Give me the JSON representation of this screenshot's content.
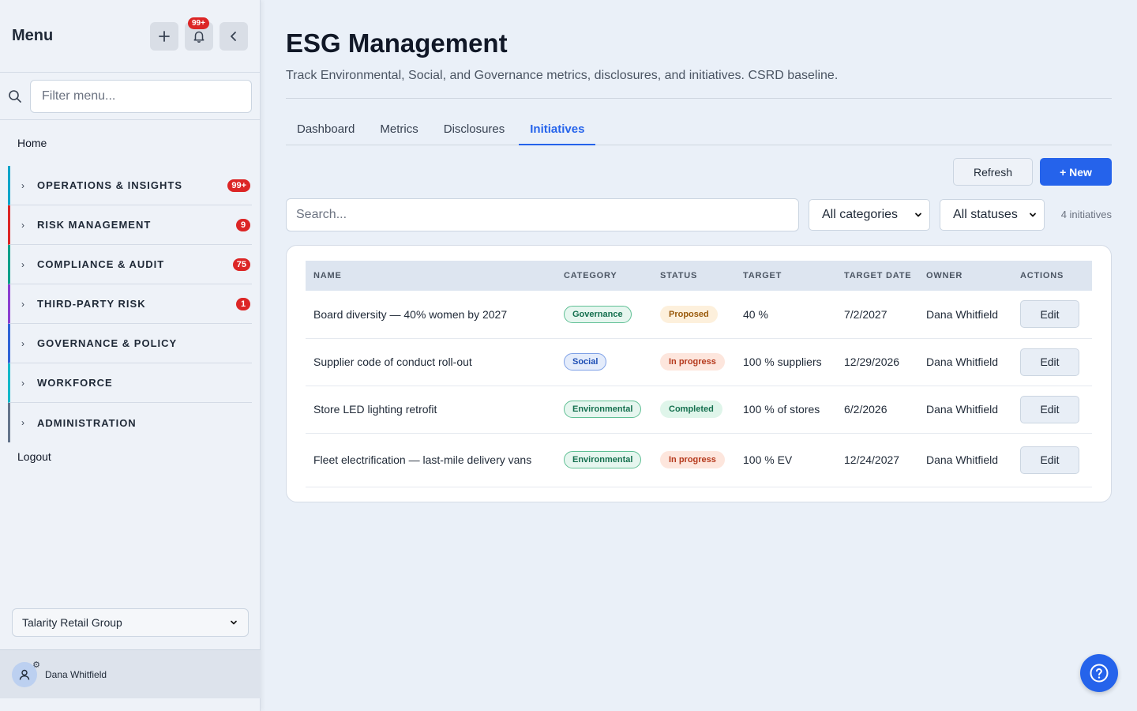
{
  "sidebar": {
    "title": "Menu",
    "notif_badge": "99+",
    "filter_placeholder": "Filter menu...",
    "home": "Home",
    "groups": [
      {
        "label": "OPERATIONS & INSIGHTS",
        "count": "99+",
        "color": "#0ea5c9"
      },
      {
        "label": "RISK MANAGEMENT",
        "count": "9",
        "color": "#dc2626"
      },
      {
        "label": "COMPLIANCE & AUDIT",
        "count": "75",
        "color": "#0f9f8a"
      },
      {
        "label": "THIRD-PARTY RISK",
        "count": "1",
        "color": "#8b3fd1"
      },
      {
        "label": "GOVERNANCE & POLICY",
        "count": "",
        "color": "#2f63d6"
      },
      {
        "label": "WORKFORCE",
        "count": "",
        "color": "#14b8c9"
      },
      {
        "label": "ADMINISTRATION",
        "count": "",
        "color": "#64748b"
      }
    ],
    "logout": "Logout",
    "org": "Talarity Retail Group",
    "user": "Dana Whitfield"
  },
  "page": {
    "title": "ESG Management",
    "subtitle": "Track Environmental, Social, and Governance metrics, disclosures, and initiatives. CSRD baseline.",
    "tabs": [
      "Dashboard",
      "Metrics",
      "Disclosures",
      "Initiatives"
    ],
    "active_tab": "Initiatives",
    "refresh": "Refresh",
    "new": "+ New",
    "search_placeholder": "Search...",
    "category_filter": "All categories",
    "status_filter": "All statuses",
    "count": "4 initiatives"
  },
  "table": {
    "headers": [
      "NAME",
      "CATEGORY",
      "STATUS",
      "TARGET",
      "TARGET DATE",
      "OWNER",
      "ACTIONS"
    ],
    "rows": [
      {
        "name": "Board diversity — 40% women by 2027",
        "category": "Governance",
        "status": "Proposed",
        "target": "40 %",
        "date": "7/2/2027",
        "owner": "Dana Whitfield",
        "action": "Edit"
      },
      {
        "name": "Supplier code of conduct roll-out",
        "category": "Social",
        "status": "In progress",
        "target": "100 % suppliers",
        "date": "12/29/2026",
        "owner": "Dana Whitfield",
        "action": "Edit"
      },
      {
        "name": "Store LED lighting retrofit",
        "category": "Environmental",
        "status": "Completed",
        "target": "100 % of stores",
        "date": "6/2/2026",
        "owner": "Dana Whitfield",
        "action": "Edit"
      },
      {
        "name": "Fleet electrification — last-mile delivery vans",
        "category": "Environmental",
        "status": "In progress",
        "target": "100 % EV",
        "date": "12/24/2027",
        "owner": "Dana Whitfield",
        "action": "Edit"
      }
    ]
  }
}
